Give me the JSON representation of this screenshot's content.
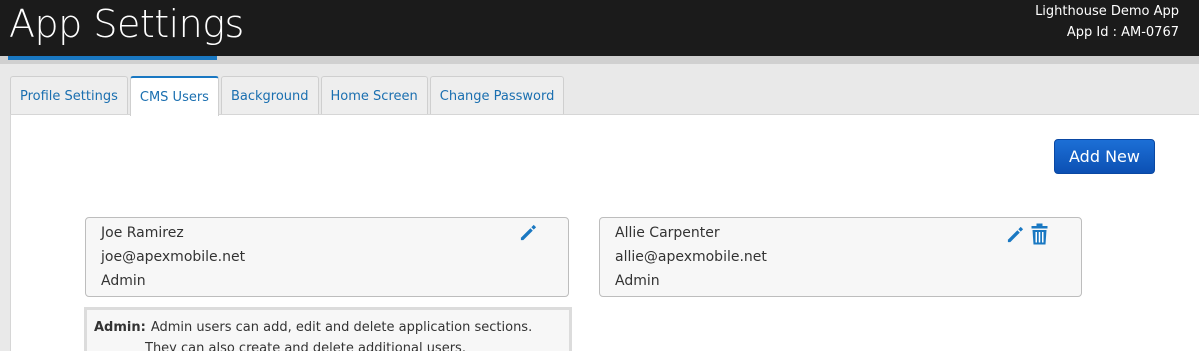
{
  "header": {
    "title": "App Settings",
    "app_name": "Lighthouse Demo App",
    "app_id": "App Id : AM-0767"
  },
  "tabs": [
    {
      "label": "Profile Settings",
      "active": false
    },
    {
      "label": "CMS Users",
      "active": true
    },
    {
      "label": "Background",
      "active": false
    },
    {
      "label": "Home Screen",
      "active": false
    },
    {
      "label": "Change Password",
      "active": false
    }
  ],
  "add_button": {
    "label": "Add New"
  },
  "users": [
    {
      "name": "Joe Ramirez",
      "email": "joe@apexmobile.net",
      "role": "Admin",
      "icons": [
        "pencil-icon"
      ]
    },
    {
      "name": "Allie Carpenter",
      "email": "allie@apexmobile.net",
      "role": "Admin",
      "icons": [
        "pencil-icon",
        "trash-icon"
      ]
    }
  ],
  "role_note": {
    "label": "Admin:",
    "line1": "Admin users can add, edit and delete application sections.",
    "line2": "They can also create and delete additional users."
  },
  "colors": {
    "header_bg": "#1b1b1b",
    "accent": "#1a78c2",
    "button_bg": "#1565c6",
    "icon_blue": "#1a78c2"
  }
}
